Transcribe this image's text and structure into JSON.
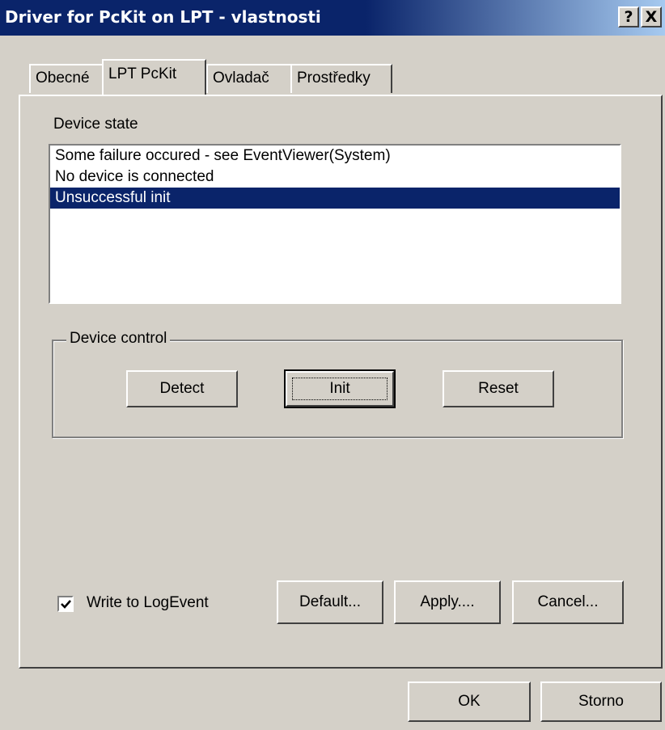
{
  "window": {
    "title": "Driver for PcKit on LPT - vlastnosti",
    "help_label": "?",
    "close_label": "X"
  },
  "tabs": [
    {
      "label": "Obecné",
      "active": false
    },
    {
      "label": "LPT PcKit",
      "active": true
    },
    {
      "label": "Ovladač",
      "active": false
    },
    {
      "label": "Prostředky",
      "active": false
    }
  ],
  "device_state": {
    "label": "Device state",
    "items": [
      {
        "text": "Some failure occured - see EventViewer(System)",
        "selected": false
      },
      {
        "text": "No device is connected",
        "selected": false
      },
      {
        "text": "Unsuccessful init",
        "selected": true
      }
    ]
  },
  "device_control": {
    "label": "Device control",
    "detect_label": "Detect",
    "init_label": "Init",
    "reset_label": "Reset"
  },
  "options": {
    "write_log_label": "Write to LogEvent",
    "write_log_checked": true,
    "default_label": "Default...",
    "apply_label": "Apply....",
    "cancel_label": "Cancel..."
  },
  "footer": {
    "ok_label": "OK",
    "storno_label": "Storno"
  }
}
